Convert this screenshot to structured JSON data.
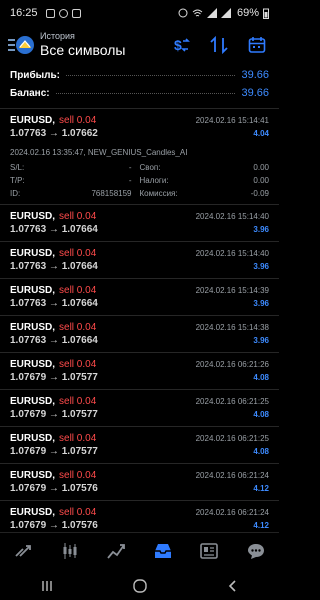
{
  "status_bar": {
    "time": "16:25",
    "battery": "69%"
  },
  "header": {
    "subtitle": "История",
    "title": "Все символы"
  },
  "summary": {
    "profit_label": "Прибыль:",
    "profit_value": "39.66",
    "balance_label": "Баланс:",
    "balance_value": "39.66"
  },
  "expanded_trade": {
    "symbol": "EURUSD,",
    "type": "sell 0.04",
    "date": "2024.02.16 15:14:41",
    "prices": "1.07763 → 1.07662",
    "profit": "4.04",
    "meta": "2024.02.16 13:35:47, NEW_GENIUS_Candles_AI",
    "sl_label": "S/L:",
    "sl_value": "-",
    "swap_label": "Своп:",
    "swap_value": "0.00",
    "tp_label": "T/P:",
    "tp_value": "-",
    "taxes_label": "Налоги:",
    "taxes_value": "0.00",
    "id_label": "ID:",
    "id_value": "768158159",
    "commission_label": "Комиссия:",
    "commission_value": "-0.09"
  },
  "trades": [
    {
      "symbol": "EURUSD,",
      "type": "sell 0.04",
      "date": "2024.02.16 15:14:40",
      "prices": "1.07763 → 1.07664",
      "profit": "3.96"
    },
    {
      "symbol": "EURUSD,",
      "type": "sell 0.04",
      "date": "2024.02.16 15:14:40",
      "prices": "1.07763 → 1.07664",
      "profit": "3.96"
    },
    {
      "symbol": "EURUSD,",
      "type": "sell 0.04",
      "date": "2024.02.16 15:14:39",
      "prices": "1.07763 → 1.07664",
      "profit": "3.96"
    },
    {
      "symbol": "EURUSD,",
      "type": "sell 0.04",
      "date": "2024.02.16 15:14:38",
      "prices": "1.07763 → 1.07664",
      "profit": "3.96"
    },
    {
      "symbol": "EURUSD,",
      "type": "sell 0.04",
      "date": "2024.02.16 06:21:26",
      "prices": "1.07679 → 1.07577",
      "profit": "4.08"
    },
    {
      "symbol": "EURUSD,",
      "type": "sell 0.04",
      "date": "2024.02.16 06:21:25",
      "prices": "1.07679 → 1.07577",
      "profit": "4.08"
    },
    {
      "symbol": "EURUSD,",
      "type": "sell 0.04",
      "date": "2024.02.16 06:21:25",
      "prices": "1.07679 → 1.07577",
      "profit": "4.08"
    },
    {
      "symbol": "EURUSD,",
      "type": "sell 0.04",
      "date": "2024.02.16 06:21:24",
      "prices": "1.07679 → 1.07576",
      "profit": "4.12"
    },
    {
      "symbol": "EURUSD,",
      "type": "sell 0.04",
      "date": "2024.02.16 06:21:24",
      "prices": "1.07679 → 1.07576",
      "profit": "4.12"
    }
  ],
  "icons": {
    "menu": "menu-icon",
    "avatar": "app-logo-icon",
    "currency": "dollar-swap-icon",
    "sort": "sort-icon",
    "calendar": "calendar-icon",
    "nav": [
      "quotes-icon",
      "chart-icon",
      "trade-icon",
      "history-icon",
      "news-icon",
      "chat-icon"
    ]
  },
  "colors": {
    "accent": "#3d8bff",
    "sell": "#ff4b4b",
    "background": "#000000"
  }
}
